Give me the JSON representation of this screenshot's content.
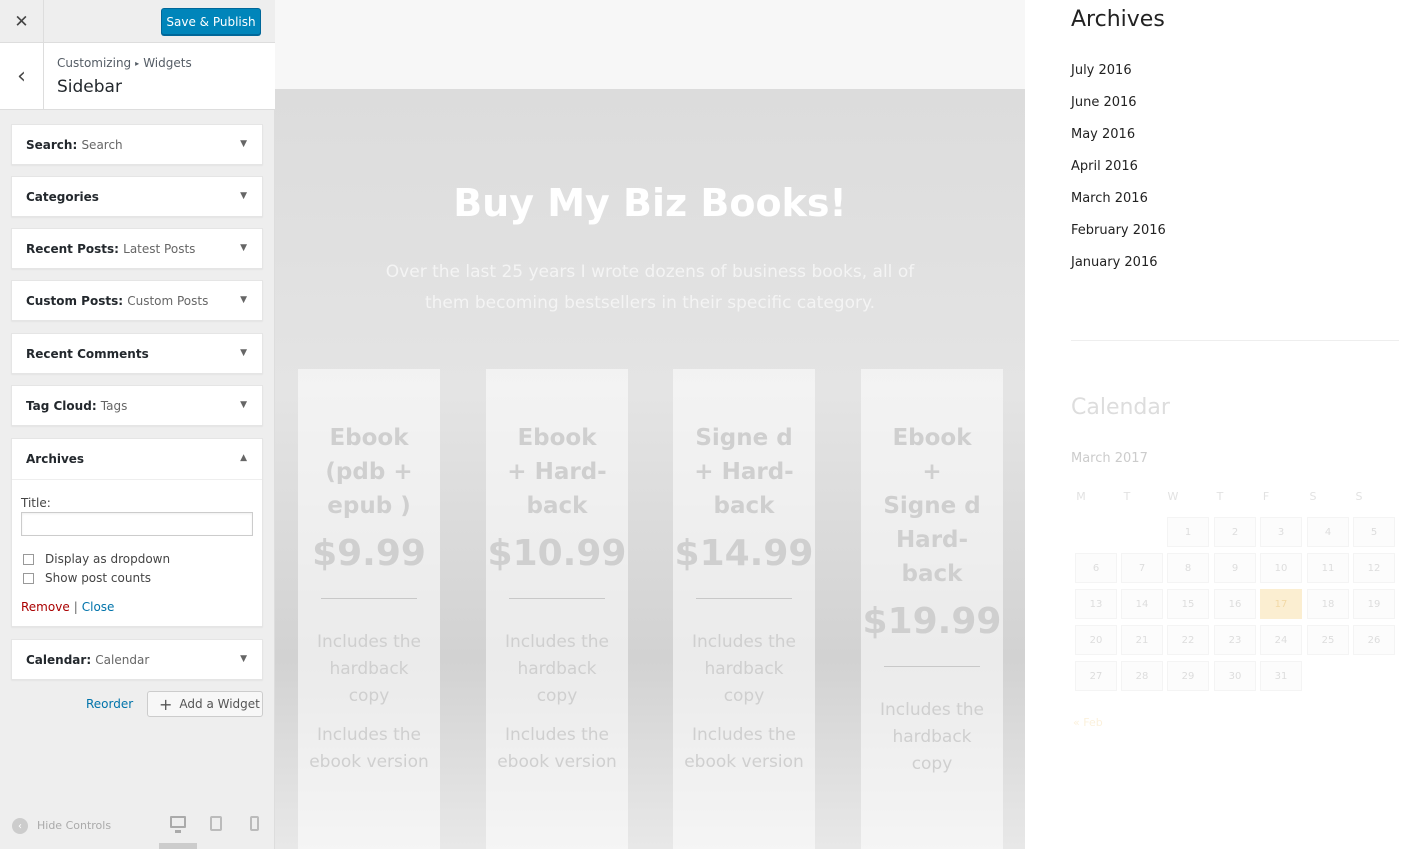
{
  "customizer": {
    "close_glyph": "✕",
    "publish_label": "Save & Publish",
    "back_glyph": "‹",
    "breadcrumb": [
      "Customizing",
      "Widgets"
    ],
    "breadcrumb_sep": "▸",
    "section_title": "Sidebar",
    "widgets": [
      {
        "title": "Search",
        "sub": "Search"
      },
      {
        "title": "Categories",
        "sub": ""
      },
      {
        "title": "Recent Posts",
        "sub": "Latest Posts"
      },
      {
        "title": "Custom Posts",
        "sub": "Custom Posts"
      },
      {
        "title": "Recent Comments",
        "sub": ""
      },
      {
        "title": "Tag Cloud",
        "sub": "Tags"
      },
      {
        "title": "Archives",
        "sub": ""
      },
      {
        "title": "Calendar",
        "sub": "Calendar"
      }
    ],
    "archives_form": {
      "title_label": "Title:",
      "title_value": "",
      "dropdown_label": "Display as dropdown",
      "counts_label": "Show post counts",
      "remove_label": "Remove",
      "separator": "|",
      "close_label": "Close"
    },
    "reorder_label": "Reorder",
    "add_widget_label": "Add a Widget",
    "hide_controls_label": "Hide Controls"
  },
  "preview": {
    "hero_title": "Buy My Biz Books!",
    "hero_subtitle": "Over the last 25 years I wrote dozens of business books, all of them becoming bestsellers in their specific category.",
    "cards": [
      {
        "title": "Ebook (pdb + epub )",
        "price": "$9.99",
        "feature1": "Includes the hardback copy",
        "feature2": "Includes the ebook version"
      },
      {
        "title": "Ebook + Hard-back",
        "price": "$10.99",
        "feature1": "Includes the hardback copy",
        "feature2": "Includes the ebook version"
      },
      {
        "title": "Signe d + Hard-back",
        "price": "$14.99",
        "feature1": "Includes the hardback copy",
        "feature2": "Includes the ebook version"
      },
      {
        "title": "Ebook + Signe d Hard-back",
        "price": "$19.99",
        "feature1": "Includes the hardback copy",
        "feature2": ""
      }
    ]
  },
  "sidebar": {
    "archives_title": "Archives",
    "archives": [
      "July 2016",
      "June 2016",
      "May 2016",
      "April 2016",
      "March 2016",
      "February 2016",
      "January 2016"
    ],
    "calendar_title": "Calendar",
    "calendar_month": "March 2017",
    "weekdays": [
      "M",
      "T",
      "W",
      "T",
      "F",
      "S",
      "S"
    ],
    "days": [
      "1",
      "2",
      "3",
      "4",
      "5",
      "6",
      "7",
      "8",
      "9",
      "10",
      "11",
      "12",
      "13",
      "14",
      "15",
      "16",
      "17",
      "18",
      "19",
      "20",
      "21",
      "22",
      "23",
      "24",
      "25",
      "26",
      "27",
      "28",
      "29",
      "30",
      "31"
    ],
    "today": "17",
    "prev_link": "« Feb"
  },
  "colors": {
    "primary": "#0085ba",
    "link": "#0073aa",
    "danger": "#aa0000",
    "today": "#fbeed1"
  }
}
